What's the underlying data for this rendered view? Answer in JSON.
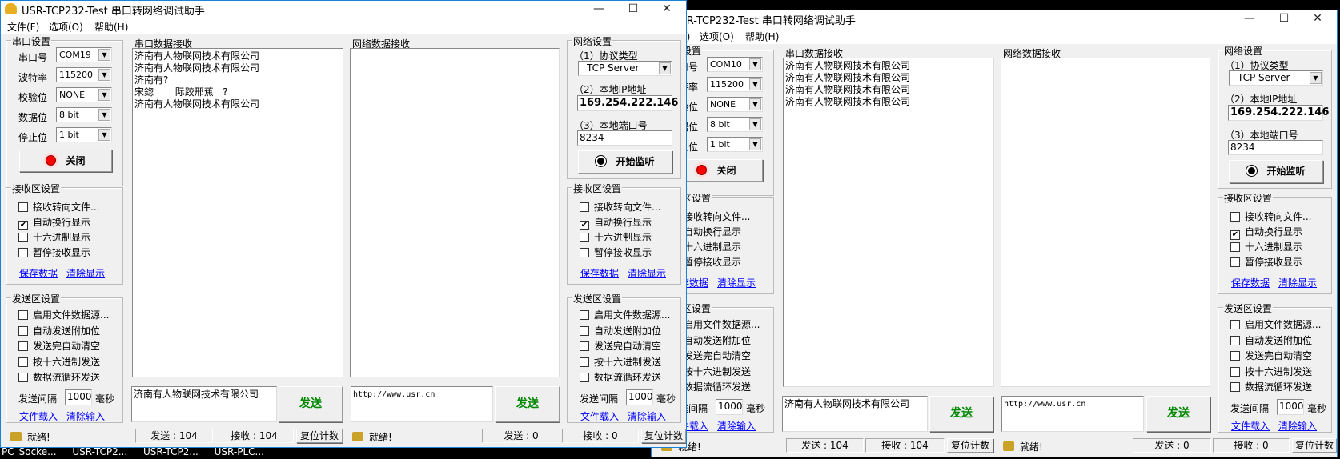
{
  "taskbar": [
    "PC_Socke...",
    "USR-TCP2...",
    "USR-TCP2...",
    "USR-PLC..."
  ],
  "colors": {
    "frame": "#1883d7",
    "send_label": "#008000",
    "link": "#0000ff",
    "indicator_on": "#ff0000"
  },
  "windows": [
    {
      "title": "USR-TCP232-Test 串口转网络调试助手",
      "menu": [
        "文件(F)",
        "选项(O)",
        "帮助(H)"
      ],
      "title_buttons": {
        "minimize": "—",
        "maximize": "☐",
        "close": "✕"
      },
      "serial": {
        "group": "串口设置",
        "port_label": "串口号",
        "port": "COM19",
        "baud_label": "波特率",
        "baud": "115200",
        "parity_label": "校验位",
        "parity": "NONE",
        "databits_label": "数据位",
        "databits": "8 bit",
        "stopbits_label": "停止位",
        "stopbits": "1 bit",
        "toggle_button": "关闭"
      },
      "serial_rx": {
        "label": "串口数据接收",
        "text": "济南有人物联网技术有限公司\n济南有人物联网技术有限公司\n济南有?\n宋鍃       际跤邢蕉   ?\n济南有人物联网技术有限公司"
      },
      "net_rx": {
        "label": "网络数据接收",
        "text": ""
      },
      "net": {
        "group": "网络设置",
        "protocol_label": "（1）协议类型",
        "protocol": "TCP Server",
        "ip_label": "（2）本地IP地址",
        "ip": "169.254.222.146",
        "port_label": "（3）本地端口号",
        "port": "8234",
        "listen_button": "开始监听"
      },
      "rx_settings": {
        "group": "接收区设置",
        "options": [
          {
            "label": "接收转向文件...",
            "checked": false
          },
          {
            "label": "自动换行显示",
            "checked": true
          },
          {
            "label": "十六进制显示",
            "checked": false
          },
          {
            "label": "暂停接收显示",
            "checked": false
          }
        ],
        "save": "保存数据",
        "clear": "清除显示"
      },
      "tx_settings": {
        "group": "发送区设置",
        "options": [
          {
            "label": "启用文件数据源...",
            "checked": false
          },
          {
            "label": "自动发送附加位",
            "checked": false
          },
          {
            "label": "发送完自动清空",
            "checked": false
          },
          {
            "label": "按十六进制发送",
            "checked": false
          },
          {
            "label": "数据流循环发送",
            "checked": false
          }
        ],
        "interval_label": "发送间隔",
        "interval": "1000",
        "unit": "毫秒",
        "load": "文件载入",
        "clear": "清除输入"
      },
      "serial_tx": {
        "text": "济南有人物联网技术有限公司",
        "send": "发送"
      },
      "net_tx": {
        "text": "http://www.usr.cn",
        "send": "发送"
      },
      "status": {
        "serial_state": "就绪!",
        "serial_sent": "发送 : 104",
        "serial_recv": "接收 : 104",
        "reset": "复位计数",
        "net_state": "就绪!",
        "net_sent": "发送 : 0",
        "net_recv": "接收 : 0"
      }
    },
    {
      "title": "USR-TCP232-Test 串口转网络调试助手",
      "menu": [
        "文件(F)",
        "选项(O)",
        "帮助(H)"
      ],
      "title_buttons": {
        "minimize": "—",
        "maximize": "☐",
        "close": "✕"
      },
      "serial": {
        "group": "串口设置",
        "port_label": "串口号",
        "port": "COM10",
        "baud_label": "波特率",
        "baud": "115200",
        "parity_label": "校验位",
        "parity": "NONE",
        "databits_label": "数据位",
        "databits": "8 bit",
        "stopbits_label": "停止位",
        "stopbits": "1 bit",
        "toggle_button": "关闭"
      },
      "serial_rx": {
        "label": "串口数据接收",
        "text": "济南有人物联网技术有限公司\n济南有人物联网技术有限公司\n济南有人物联网技术有限公司\n济南有人物联网技术有限公司"
      },
      "net_rx": {
        "label": "网络数据接收",
        "text": ""
      },
      "net": {
        "group": "网络设置",
        "protocol_label": "（1）协议类型",
        "protocol": "TCP Server",
        "ip_label": "（2）本地IP地址",
        "ip": "169.254.222.146",
        "port_label": "（3）本地端口号",
        "port": "8234",
        "listen_button": "开始监听"
      },
      "rx_settings": {
        "group": "接收区设置",
        "options": [
          {
            "label": "接收转向文件...",
            "checked": false
          },
          {
            "label": "自动换行显示",
            "checked": true
          },
          {
            "label": "十六进制显示",
            "checked": false
          },
          {
            "label": "暂停接收显示",
            "checked": false
          }
        ],
        "save": "保存数据",
        "clear": "清除显示"
      },
      "tx_settings": {
        "group": "发送区设置",
        "options": [
          {
            "label": "启用文件数据源...",
            "checked": false
          },
          {
            "label": "自动发送附加位",
            "checked": false
          },
          {
            "label": "发送完自动清空",
            "checked": false
          },
          {
            "label": "按十六进制发送",
            "checked": false
          },
          {
            "label": "数据流循环发送",
            "checked": false
          }
        ],
        "interval_label": "发送间隔",
        "interval": "1000",
        "unit": "毫秒",
        "load": "文件载入",
        "clear": "清除输入"
      },
      "serial_tx": {
        "text": "济南有人物联网技术有限公司",
        "send": "发送"
      },
      "net_tx": {
        "text": "http://www.usr.cn",
        "send": "发送"
      },
      "status": {
        "serial_state": "就绪!",
        "serial_sent": "发送 : 104",
        "serial_recv": "接收 : 104",
        "reset": "复位计数",
        "net_state": "就绪!",
        "net_sent": "发送 : 0",
        "net_recv": "接收 : 0"
      }
    }
  ]
}
